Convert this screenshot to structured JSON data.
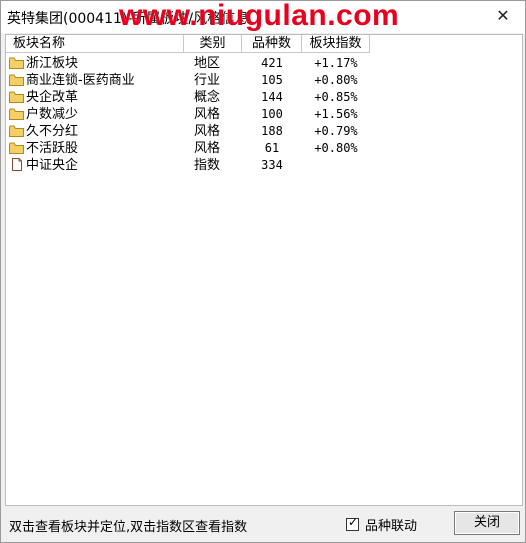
{
  "window": {
    "title": "英特集团(000411)-所属板块/风格信息",
    "watermark": "www.niugulan.com",
    "close_glyph": "✕"
  },
  "table": {
    "headers": [
      "板块名称",
      "类别",
      "品种数",
      "板块指数"
    ],
    "rows": [
      {
        "name": "浙江板块",
        "type": "地区",
        "count": "421",
        "index": "+1.17%",
        "icon": "folder-icon"
      },
      {
        "name": "商业连锁-医药商业",
        "type": "行业",
        "count": "105",
        "index": "+0.80%",
        "icon": "folder-icon"
      },
      {
        "name": "央企改革",
        "type": "概念",
        "count": "144",
        "index": "+0.85%",
        "icon": "folder-icon"
      },
      {
        "name": "户数减少",
        "type": "风格",
        "count": "100",
        "index": "+1.56%",
        "icon": "folder-icon"
      },
      {
        "name": "久不分红",
        "type": "风格",
        "count": "188",
        "index": "+0.79%",
        "icon": "folder-icon"
      },
      {
        "name": "不活跃股",
        "type": "风格",
        "count": "61",
        "index": "+0.80%",
        "icon": "folder-icon"
      },
      {
        "name": "中证央企",
        "type": "指数",
        "count": "334",
        "index": "",
        "icon": "document-icon"
      }
    ]
  },
  "footer": {
    "hint": "双击查看板块并定位,双击指数区查看指数",
    "checkbox_label": "品种联动",
    "checkbox_checked": true,
    "close_button": "关闭"
  },
  "colors": {
    "folder": "#e8c24a",
    "watermark": "#e8001c"
  }
}
